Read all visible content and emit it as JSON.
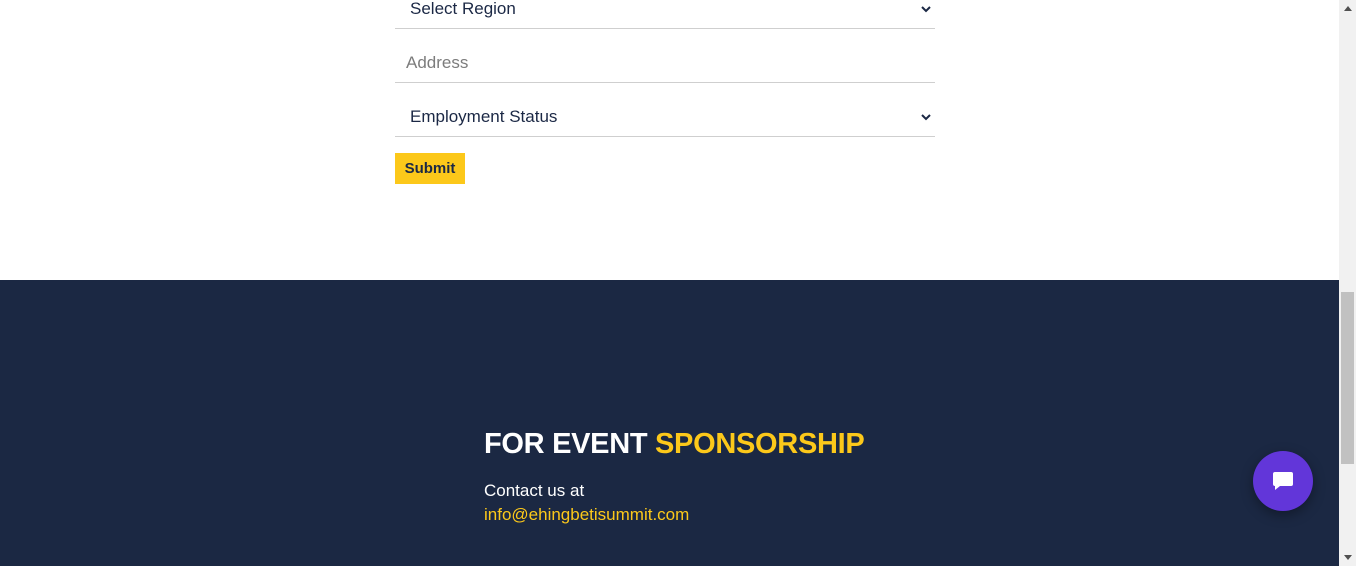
{
  "form": {
    "region_select": {
      "value": "Select Region"
    },
    "address_input": {
      "placeholder": "Address"
    },
    "employment_select": {
      "value": "Employment Status"
    },
    "submit_label": "Submit"
  },
  "footer": {
    "heading_part1": "FOR EVENT ",
    "heading_part2": "SPONSORSHIP",
    "contact_label": "Contact us at",
    "email": "info@ehingbetisummit.com"
  },
  "icons": {
    "chevron": "chevron-down-icon",
    "chat": "chat-bubble-icon"
  },
  "colors": {
    "accent": "#fcc81a",
    "footer_bg": "#1b2843",
    "text_dark": "#1b2845",
    "chat_button": "#6236d9"
  }
}
